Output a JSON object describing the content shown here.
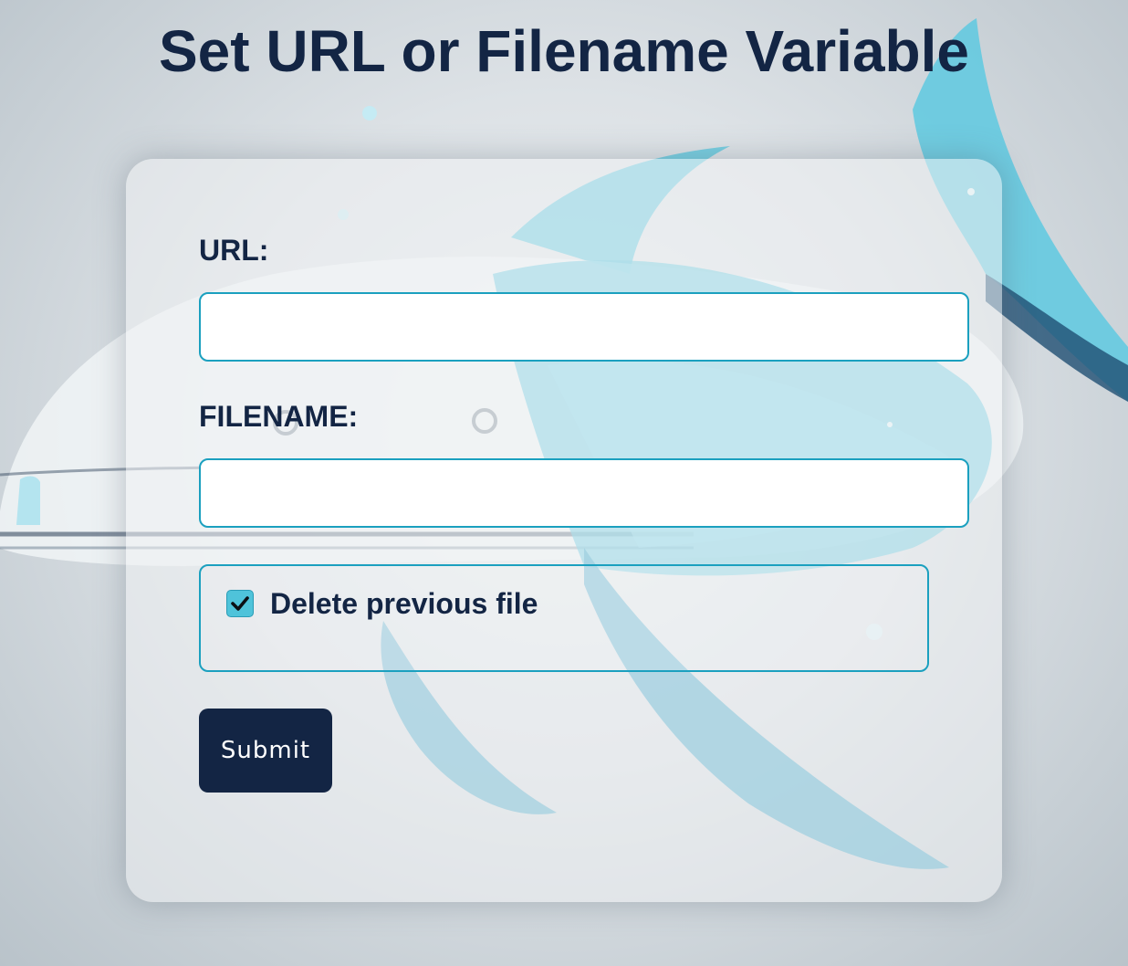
{
  "page": {
    "title": "Set URL or Filename Variable"
  },
  "form": {
    "url_label": "URL:",
    "url_value": "",
    "filename_label": "FILENAME:",
    "filename_value": "",
    "delete_previous": {
      "label": "Delete previous file",
      "checked": true
    },
    "submit_label": "Submit"
  },
  "background": {
    "icon": "robot-whale-illustration",
    "colors": {
      "whale_blue": "#5ec9e0",
      "whale_dark": "#1f4f73",
      "hull_white": "#f4f7f9"
    }
  },
  "colors": {
    "heading": "#132544",
    "input_border": "#1ba0bf",
    "button_bg": "#132544",
    "button_text": "#ffffff",
    "checkbox_fill": "#4fc3da"
  }
}
